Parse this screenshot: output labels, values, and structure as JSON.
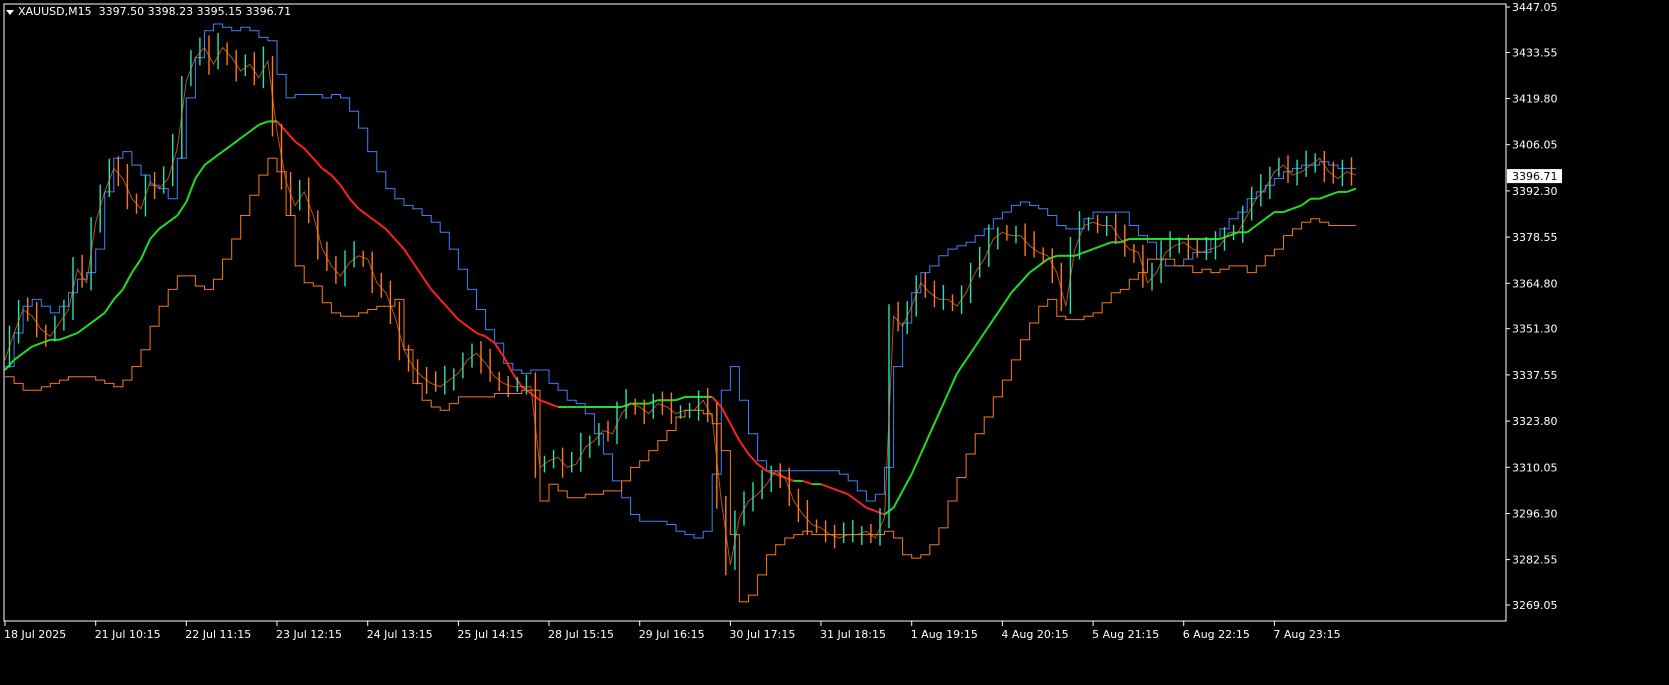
{
  "header": {
    "symbol_timeframe": "XAUUSD,M15",
    "open": "3397.50",
    "high": "3398.23",
    "low": "3395.15",
    "close": "3396.71"
  },
  "current_price_label": "3396.71",
  "colors": {
    "background": "#000000",
    "frame": "#ffffff",
    "upper_band": "#3b82f6",
    "lower_band": "#f47a1a",
    "ma_up": "#22dd22",
    "ma_down": "#ff2020",
    "candle_bull": "#22e6b8",
    "candle_bear": "#ff7a1a",
    "price_tag_bg": "#ffffff",
    "price_tag_text": "#000000"
  },
  "chart_data": {
    "type": "line",
    "title": "",
    "grid": false,
    "ylim": [
      3262.0,
      3447.05
    ],
    "y_ticks": [
      "3447.05",
      "3433.55",
      "3419.80",
      "3406.05",
      "3392.30",
      "3378.55",
      "3364.80",
      "3351.30",
      "3337.55",
      "3323.80",
      "3310.05",
      "3296.30",
      "3282.55",
      "3269.05"
    ],
    "x_ticks": [
      "18 Jul 2025",
      "21 Jul 10:15",
      "22 Jul 11:15",
      "23 Jul 12:15",
      "24 Jul 13:15",
      "25 Jul 14:15",
      "28 Jul 15:15",
      "29 Jul 16:15",
      "30 Jul 17:15",
      "31 Jul 18:15",
      "1 Aug 19:15",
      "4 Aug 20:15",
      "5 Aug 21:15",
      "6 Aug 22:15",
      "7 Aug 23:15"
    ],
    "x_tick_index": [
      0,
      10,
      20,
      30,
      40,
      50,
      60,
      70,
      80,
      90,
      100,
      110,
      120,
      130,
      140
    ],
    "x_index_max": 149,
    "series": [
      {
        "role": "upper_band",
        "values": [
          3340,
          3350,
          3358,
          3360,
          3358,
          3356,
          3358,
          3362,
          3366,
          3368,
          3375,
          3392,
          3402,
          3404,
          3400,
          3397,
          3394,
          3393,
          3390,
          3402,
          3420,
          3432,
          3440,
          3442,
          3441,
          3440,
          3441,
          3440,
          3438,
          3437,
          3427,
          3420,
          3421,
          3421,
          3421,
          3420,
          3421,
          3420,
          3416,
          3411,
          3404,
          3398,
          3393,
          3390,
          3388,
          3387,
          3385,
          3383,
          3380,
          3375,
          3369,
          3363,
          3357,
          3351,
          3347,
          3341,
          3339,
          3338,
          3339,
          3339,
          3335,
          3333,
          3330,
          3329,
          3326,
          3320,
          3314,
          3306,
          3301,
          3296,
          3294,
          3294,
          3294,
          3293,
          3291,
          3290,
          3289,
          3291,
          3308,
          3333,
          3340,
          3330,
          3320,
          3312,
          3309,
          3309,
          3309,
          3309,
          3309,
          3309,
          3309,
          3309,
          3308,
          3306,
          3303,
          3300,
          3302,
          3310,
          3340,
          3353,
          3362,
          3368,
          3370,
          3373,
          3375,
          3376,
          3377,
          3379,
          3381,
          3384,
          3386,
          3388,
          3389,
          3388,
          3387,
          3385,
          3382,
          3381,
          3381,
          3384,
          3386,
          3386,
          3386,
          3386,
          3382,
          3379,
          3377,
          3372,
          3370,
          3370,
          3372,
          3374,
          3374,
          3378,
          3381,
          3384,
          3386,
          3390,
          3392,
          3394,
          3396,
          3398,
          3399,
          3400,
          3400,
          3401,
          3400,
          3399,
          3399,
          3399
        ]
      },
      {
        "role": "lower_band",
        "values": [
          3337,
          3335,
          3333,
          3333,
          3334,
          3335,
          3336,
          3337,
          3337,
          3337,
          3336,
          3335,
          3334,
          3336,
          3340,
          3345,
          3352,
          3358,
          3363,
          3367,
          3367,
          3364,
          3363,
          3366,
          3372,
          3378,
          3385,
          3391,
          3397,
          3402,
          3398,
          3385,
          3370,
          3365,
          3364,
          3359,
          3356,
          3355,
          3355,
          3356,
          3357,
          3358,
          3358,
          3360,
          3345,
          3335,
          3330,
          3328,
          3327,
          3329,
          3331,
          3331,
          3331,
          3331,
          3332,
          3332,
          3332,
          3333,
          3333,
          3300,
          3305,
          3303,
          3301,
          3301,
          3302,
          3302,
          3303,
          3303,
          3306,
          3310,
          3312,
          3315,
          3318,
          3321,
          3325,
          3327,
          3327,
          3326,
          3323,
          3315,
          3290,
          3270,
          3272,
          3278,
          3284,
          3287,
          3289,
          3290,
          3291,
          3290,
          3290,
          3290,
          3290,
          3290,
          3290,
          3290,
          3290,
          3291,
          3289,
          3284,
          3283,
          3284,
          3287,
          3292,
          3300,
          3307,
          3314,
          3320,
          3325,
          3331,
          3336,
          3342,
          3348,
          3353,
          3358,
          3360,
          3355,
          3354,
          3354,
          3355,
          3356,
          3359,
          3362,
          3363,
          3366,
          3368,
          3372,
          3372,
          3372,
          3370,
          3370,
          3368,
          3369,
          3368,
          3369,
          3370,
          3370,
          3368,
          3370,
          3373,
          3375,
          3379,
          3381,
          3383,
          3384,
          3383,
          3382,
          3382,
          3382,
          3382
        ]
      },
      {
        "role": "moving_average",
        "values": [
          3339,
          3342,
          3344,
          3346,
          3347,
          3348,
          3348,
          3349,
          3350,
          3352,
          3354,
          3356,
          3360,
          3363,
          3368,
          3372,
          3378,
          3381,
          3383,
          3385,
          3389,
          3396,
          3400,
          3402,
          3404,
          3406,
          3408,
          3410,
          3412,
          3413,
          3413,
          3410,
          3407,
          3405,
          3402,
          3399,
          3397,
          3394,
          3390,
          3387,
          3385,
          3383,
          3381,
          3378,
          3375,
          3371,
          3367,
          3363,
          3360,
          3357,
          3354,
          3352,
          3350,
          3349,
          3347,
          3343,
          3338,
          3334,
          3332,
          3330,
          3329,
          3328,
          3328,
          3328,
          3328,
          3328,
          3328,
          3328,
          3328,
          3329,
          3329,
          3329,
          3330,
          3330,
          3330,
          3331,
          3331,
          3331,
          3331,
          3328,
          3323,
          3318,
          3314,
          3311,
          3309,
          3308,
          3307,
          3306,
          3306,
          3305,
          3305,
          3304,
          3303,
          3302,
          3300,
          3298,
          3297,
          3296,
          3298,
          3303,
          3308,
          3314,
          3320,
          3326,
          3332,
          3338,
          3342,
          3346,
          3350,
          3354,
          3358,
          3362,
          3365,
          3368,
          3370,
          3372,
          3373,
          3373,
          3373,
          3374,
          3375,
          3376,
          3377,
          3377,
          3378,
          3378,
          3378,
          3378,
          3378,
          3378,
          3378,
          3378,
          3378,
          3378,
          3378,
          3379,
          3380,
          3380,
          3382,
          3384,
          3386,
          3386,
          3387,
          3388,
          3390,
          3390,
          3391,
          3392,
          3392,
          3393
        ]
      },
      {
        "role": "price_close",
        "values": [
          3342,
          3350,
          3357,
          3355,
          3351,
          3349,
          3353,
          3357,
          3369,
          3365,
          3383,
          3392,
          3399,
          3396,
          3390,
          3387,
          3395,
          3393,
          3396,
          3405,
          3425,
          3432,
          3435,
          3430,
          3435,
          3432,
          3428,
          3430,
          3426,
          3431,
          3410,
          3395,
          3388,
          3392,
          3385,
          3375,
          3370,
          3367,
          3371,
          3373,
          3372,
          3365,
          3362,
          3355,
          3345,
          3340,
          3337,
          3335,
          3334,
          3336,
          3338,
          3342,
          3344,
          3341,
          3337,
          3335,
          3334,
          3334,
          3334,
          3310,
          3312,
          3313,
          3310,
          3311,
          3316,
          3318,
          3321,
          3320,
          3326,
          3329,
          3328,
          3326,
          3329,
          3328,
          3326,
          3327,
          3327,
          3330,
          3325,
          3300,
          3281,
          3295,
          3300,
          3302,
          3305,
          3309,
          3307,
          3300,
          3296,
          3293,
          3292,
          3290,
          3289,
          3290,
          3290,
          3291,
          3289,
          3295,
          3355,
          3352,
          3358,
          3365,
          3362,
          3360,
          3360,
          3358,
          3362,
          3368,
          3372,
          3378,
          3380,
          3379,
          3379,
          3376,
          3374,
          3373,
          3368,
          3358,
          3375,
          3382,
          3383,
          3382,
          3382,
          3378,
          3375,
          3374,
          3365,
          3368,
          3374,
          3376,
          3377,
          3375,
          3374,
          3375,
          3376,
          3380,
          3380,
          3385,
          3390,
          3393,
          3398,
          3400,
          3397,
          3398,
          3400,
          3402,
          3398,
          3396,
          3398,
          3397
        ]
      }
    ]
  }
}
